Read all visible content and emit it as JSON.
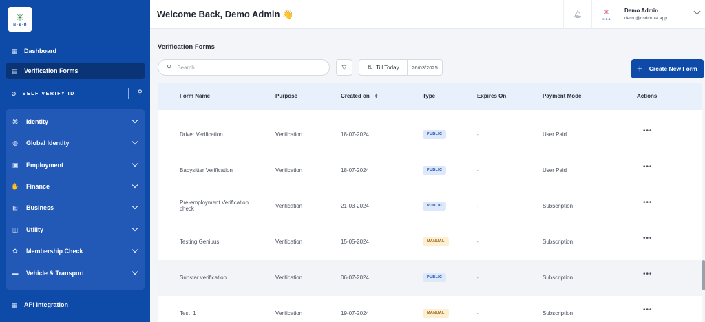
{
  "sidebar": {
    "logo_text": "N·S·D",
    "top_items": [
      {
        "label": "Dashboard",
        "icon": "dashboard-icon"
      },
      {
        "label": "Verification Forms",
        "icon": "forms-icon"
      }
    ],
    "section_label": "SELF VERIFY ID",
    "categories": [
      {
        "label": "Identity",
        "icon": "identity-icon"
      },
      {
        "label": "Global Identity",
        "icon": "globe-icon"
      },
      {
        "label": "Employment",
        "icon": "employment-icon"
      },
      {
        "label": "Finance",
        "icon": "finance-icon"
      },
      {
        "label": "Business",
        "icon": "briefcase-icon"
      },
      {
        "label": "Utility",
        "icon": "utility-icon"
      },
      {
        "label": "Membership Check",
        "icon": "membership-icon"
      },
      {
        "label": "Vehicle & Transport",
        "icon": "vehicle-icon"
      }
    ],
    "bottom_item": {
      "label": "API Integration",
      "icon": "api-icon"
    }
  },
  "header": {
    "welcome": "Welcome Back, Demo Admin 👋",
    "user_name": "Demo Admin",
    "user_email": "demo@nsdctrust.app",
    "avatar_text": "N·S·D"
  },
  "main": {
    "title": "Verification Forms",
    "search_placeholder": "Search",
    "till_label": "Till Today",
    "date": "26/03/2025",
    "create_label": "Create New Form",
    "columns": [
      "Form Name",
      "Purpose",
      "Created on",
      "Type",
      "Expires On",
      "Payment Mode",
      "Actions"
    ],
    "rows": [
      {
        "name": "Driver Verification",
        "purpose": "Verification",
        "created": "18-07-2024",
        "type": "PUBLIC",
        "expires": "-",
        "payment": "User Paid"
      },
      {
        "name": "Babysitter Verification",
        "purpose": "Verification",
        "created": "18-07-2024",
        "type": "PUBLIC",
        "expires": "-",
        "payment": "User Paid"
      },
      {
        "name": "Pre-employment Verification check",
        "purpose": "Verification",
        "created": "21-03-2024",
        "type": "PUBLIC",
        "expires": "-",
        "payment": "Subscription"
      },
      {
        "name": "Testing Geniuus",
        "purpose": "Verification",
        "created": "15-05-2024",
        "type": "MANUAL",
        "expires": "-",
        "payment": "Subscription"
      },
      {
        "name": "Sunstar verification",
        "purpose": "Verification",
        "created": "06-07-2024",
        "type": "PUBLIC",
        "expires": "-",
        "payment": "Subscription"
      },
      {
        "name": "Test_1",
        "purpose": "Verification",
        "created": "19-07-2024",
        "type": "MANUAL",
        "expires": "-",
        "payment": "Subscription"
      }
    ],
    "actions_glyph": "•••"
  },
  "colors": {
    "brand": "#0e4aa8",
    "sidebar_active": "#0a3476",
    "public_badge": "#dde9fb",
    "manual_badge": "#fdefd3"
  }
}
